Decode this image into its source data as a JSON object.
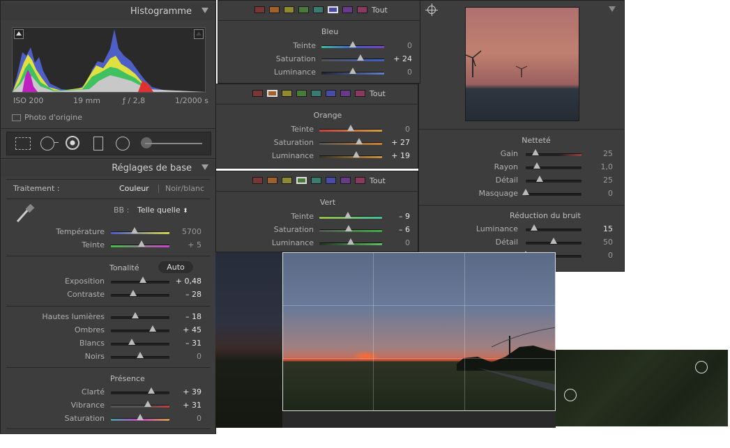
{
  "left_panel": {
    "histogram_title": "Histogramme",
    "exif": {
      "iso": "ISO 200",
      "focal": "19 mm",
      "aperture": "ƒ / 2,8",
      "shutter": "1/2000 s"
    },
    "original_photo_label": "Photo d'origine",
    "basic_title": "Réglages de base",
    "treatment_label": "Traitement :",
    "treatment_color": "Couleur",
    "treatment_bw": "Noir/blanc",
    "wb_label": "BB :",
    "wb_value": "Telle quelle",
    "wb_arrow": "⬍",
    "temperature": {
      "label": "Température",
      "value": "5700",
      "pos": 0.4
    },
    "tint": {
      "label": "Teinte",
      "value": "+ 5",
      "pos": 0.52
    },
    "tone_label": "Tonalité",
    "auto_label": "Auto",
    "exposure": {
      "label": "Exposition",
      "value": "+ 0,48",
      "pos": 0.55
    },
    "contrast": {
      "label": "Contraste",
      "value": "– 28",
      "pos": 0.38
    },
    "highlights": {
      "label": "Hautes lumières",
      "value": "– 18",
      "pos": 0.42
    },
    "shadows": {
      "label": "Ombres",
      "value": "+ 45",
      "pos": 0.72
    },
    "whites": {
      "label": "Blancs",
      "value": "– 31",
      "pos": 0.36
    },
    "blacks": {
      "label": "Noirs",
      "value": "0",
      "pos": 0.5
    },
    "presence_label": "Présence",
    "clarity": {
      "label": "Clarté",
      "value": "+ 39",
      "pos": 0.69
    },
    "vibrance": {
      "label": "Vibrance",
      "value": "+ 31",
      "pos": 0.63
    },
    "saturation": {
      "label": "Saturation",
      "value": "0",
      "pos": 0.5
    }
  },
  "hsl_panels": [
    {
      "all_label": "Tout",
      "color_label": "Bleu",
      "selected": 5,
      "rows": [
        {
          "label": "Teinte",
          "value": "0",
          "pos": 0.5
        },
        {
          "label": "Saturation",
          "value": "+ 24",
          "pos": 0.62
        },
        {
          "label": "Luminance",
          "value": "0",
          "pos": 0.5
        }
      ]
    },
    {
      "all_label": "Tout",
      "color_label": "Orange",
      "selected": 1,
      "rows": [
        {
          "label": "Teinte",
          "value": "0",
          "pos": 0.5
        },
        {
          "label": "Saturation",
          "value": "+ 27",
          "pos": 0.63
        },
        {
          "label": "Luminance",
          "value": "+ 19",
          "pos": 0.59
        }
      ]
    },
    {
      "all_label": "Tout",
      "color_label": "Vert",
      "selected": 3,
      "rows": [
        {
          "label": "Teinte",
          "value": "– 9",
          "pos": 0.46
        },
        {
          "label": "Saturation",
          "value": "– 6",
          "pos": 0.47
        },
        {
          "label": "Luminance",
          "value": "0",
          "pos": 0.5
        }
      ]
    }
  ],
  "swatch_colors": [
    "#7a3535",
    "#a0602a",
    "#8f8a30",
    "#4a7a3a",
    "#3a7a70",
    "#4a4aa8",
    "#6a3a8a",
    "#8a3a60"
  ],
  "detail_panel": {
    "sharpening_title": "Netteté",
    "sharpening": [
      {
        "label": "Gain",
        "value": "25",
        "pos": 0.17
      },
      {
        "label": "Rayon",
        "value": "1,0",
        "pos": 0.2
      },
      {
        "label": "Détail",
        "value": "25",
        "pos": 0.25
      },
      {
        "label": "Masquage",
        "value": "0",
        "pos": 0.0
      }
    ],
    "noise_title": "Réduction du bruit",
    "noise": [
      {
        "label": "Luminance",
        "value": "15",
        "pos": 0.15
      },
      {
        "label": "Détail",
        "value": "50",
        "pos": 0.5
      },
      {
        "label": "",
        "value": "0",
        "pos": 0.0
      }
    ]
  },
  "colors": {
    "panel_bg": "#3d3d3d",
    "header_bg": "#3a3a3a",
    "text": "#b0b0b0",
    "value_bright": "#e8e8e8"
  }
}
